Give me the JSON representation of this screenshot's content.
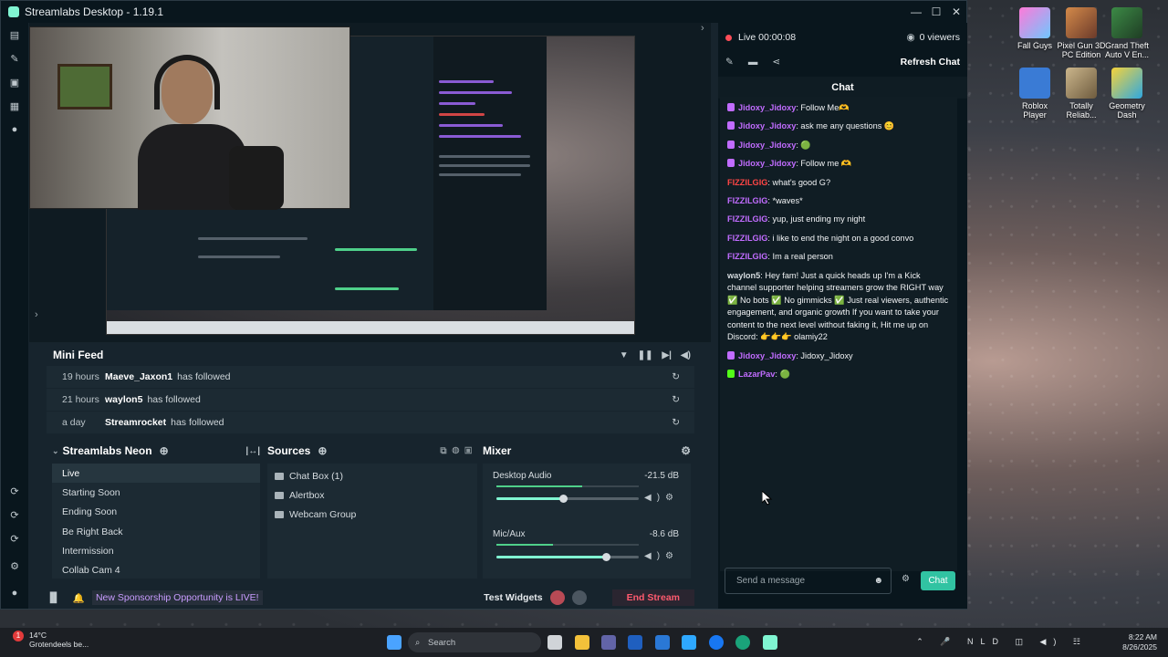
{
  "app": {
    "title": "Streamlabs Desktop - 1.19.1"
  },
  "desktop_icons": [
    {
      "label": "Fall Guys",
      "color": "#8fd3ff"
    },
    {
      "label": "Pixel Gun 3D PC Edition",
      "color": "#c96b3a"
    },
    {
      "label": "Grand Theft Auto V En...",
      "color": "#2f6a3a"
    },
    {
      "label": "Roblox Player",
      "color": "#3a7bd5"
    },
    {
      "label": "Totally Reliab...",
      "color": "#b7a27a"
    },
    {
      "label": "Geometry Dash",
      "color": "#2fa8e0"
    }
  ],
  "mini_feed": {
    "title": "Mini Feed",
    "rows": [
      {
        "time": "19 hours",
        "user": "Maeve_Jaxon1",
        "action": "has followed"
      },
      {
        "time": "21 hours",
        "user": "waylon5",
        "action": "has followed"
      },
      {
        "time": "a day",
        "user": "Streamrocket",
        "action": "has followed"
      }
    ]
  },
  "scenes": {
    "title": "Streamlabs Neon",
    "items": [
      "Live",
      "Starting Soon",
      "Ending Soon",
      "Be Right Back",
      "Intermission",
      "Collab Cam 4"
    ]
  },
  "sources": {
    "title": "Sources",
    "items": [
      "Chat Box (1)",
      "Alertbox",
      "Webcam Group"
    ]
  },
  "mixer": {
    "title": "Mixer",
    "channels": [
      {
        "name": "Desktop Audio",
        "db": "-21.5 dB",
        "level": 0.6,
        "volume": 0.47
      },
      {
        "name": "Mic/Aux",
        "db": "-8.6 dB",
        "level": 0.4,
        "volume": 0.77
      }
    ]
  },
  "footer": {
    "promo": "New Sponsorship Opportunity is LIVE!",
    "test_widgets": "Test Widgets",
    "end_stream": "End Stream"
  },
  "chat_panel": {
    "live_time": "Live 00:00:08",
    "viewers": "0 viewers",
    "refresh": "Refresh Chat",
    "title": "Chat",
    "input_placeholder": "Send a message",
    "chat_button": "Chat",
    "messages": [
      {
        "name": "Jidoxy_Jidoxy",
        "text": ": Follow Me🫶",
        "name_color": "#c16cff",
        "badge": "#c16cff"
      },
      {
        "name": "Jidoxy_Jidoxy",
        "text": ": ask me any questions 😊",
        "name_color": "#c16cff",
        "badge": "#c16cff"
      },
      {
        "name": "Jidoxy_Jidoxy",
        "text": ": 🟢",
        "name_color": "#c16cff",
        "badge": "#c16cff"
      },
      {
        "name": "Jidoxy_Jidoxy",
        "text": ": Follow me 🫶",
        "name_color": "#c16cff",
        "badge": "#c16cff"
      },
      {
        "name": "FIZZILGIG",
        "text": ": what's good G?",
        "name_color": "#ff4545",
        "badge": ""
      },
      {
        "name": "FIZZILGIG",
        "text": ": *waves*",
        "name_color": "#c16cff",
        "badge": ""
      },
      {
        "name": "FIZZILGIG",
        "text": ": yup, just ending my night",
        "name_color": "#c16cff",
        "badge": ""
      },
      {
        "name": "FIZZILGIG",
        "text": ": i like to end the night on a good convo",
        "name_color": "#c16cff",
        "badge": ""
      },
      {
        "name": "FIZZILGIG",
        "text": ": Im a real person",
        "name_color": "#c16cff",
        "badge": ""
      },
      {
        "name": "waylon5",
        "text": ": Hey fam! Just a quick heads up I'm a Kick channel supporter helping streamers grow the RIGHT way ✅ No bots ✅ No gimmicks ✅ Just real viewers, authentic engagement, and organic growth If you want to take your content to the next level without faking it, Hit me up on Discord: 👉👉👉 olamiy22",
        "name_color": "#d6dce0",
        "badge": ""
      },
      {
        "name": "Jidoxy_Jidoxy",
        "text": ": Jidoxy_Jidoxy",
        "name_color": "#c16cff",
        "badge": "#c16cff"
      },
      {
        "name": "LazarPav",
        "text": ": 🟢",
        "name_color": "#c16cff",
        "badge": "#53fc18"
      }
    ]
  },
  "taskbar": {
    "weather_temp": "14°C",
    "weather_desc": "Grotendeels be...",
    "notification_count": "1",
    "search": "Search",
    "lang": "NLD",
    "time": "8:22 AM",
    "date": "8/26/2025"
  }
}
